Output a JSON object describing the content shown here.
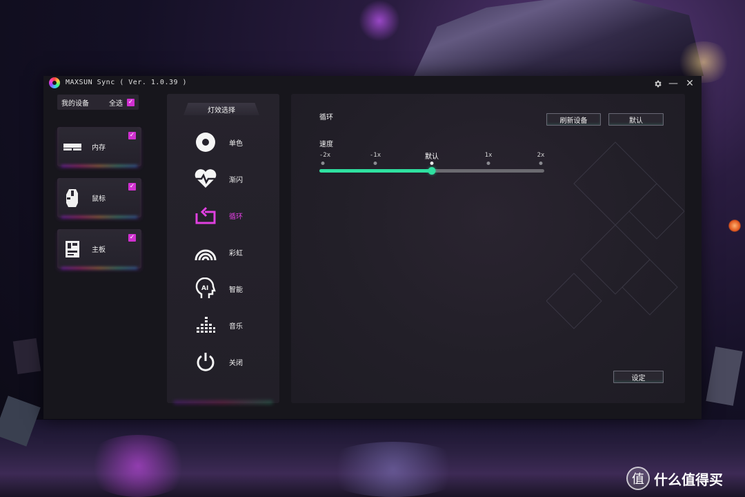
{
  "window": {
    "title": "MAXSUN Sync ( Ver. 1.0.39 )",
    "settings_icon": "gear-icon",
    "minimize_glyph": "—",
    "close_glyph": "✕"
  },
  "devices": {
    "header_label": "我的设备",
    "select_all_label": "全选",
    "select_all_checked": true,
    "items": [
      {
        "label": "内存",
        "icon": "memory-icon",
        "checked": true
      },
      {
        "label": "鼠标",
        "icon": "mouse-icon",
        "checked": true
      },
      {
        "label": "主板",
        "icon": "motherboard-icon",
        "checked": true
      }
    ]
  },
  "effects": {
    "title": "灯效选择",
    "active_index": 2,
    "accent_color": "#e040e0",
    "items": [
      {
        "label": "单色",
        "icon": "disc-icon"
      },
      {
        "label": "渐闪",
        "icon": "heartbeat-icon"
      },
      {
        "label": "循环",
        "icon": "cycle-icon"
      },
      {
        "label": "彩虹",
        "icon": "rainbow-icon"
      },
      {
        "label": "智能",
        "icon": "ai-head-icon"
      },
      {
        "label": "音乐",
        "icon": "equalizer-icon"
      },
      {
        "label": "关闭",
        "icon": "power-icon"
      }
    ]
  },
  "settings": {
    "mode_title": "循环",
    "refresh_button": "刷新设备",
    "default_button": "默认",
    "speed_label": "速度",
    "speed_ticks": [
      "-2x",
      "-1x",
      "默认",
      "1x",
      "2x"
    ],
    "speed_selected_index": 2,
    "slider_color": "#2fe0a0",
    "apply_button": "设定"
  },
  "watermark": {
    "logo_glyph": "值",
    "text": "什么值得买"
  }
}
